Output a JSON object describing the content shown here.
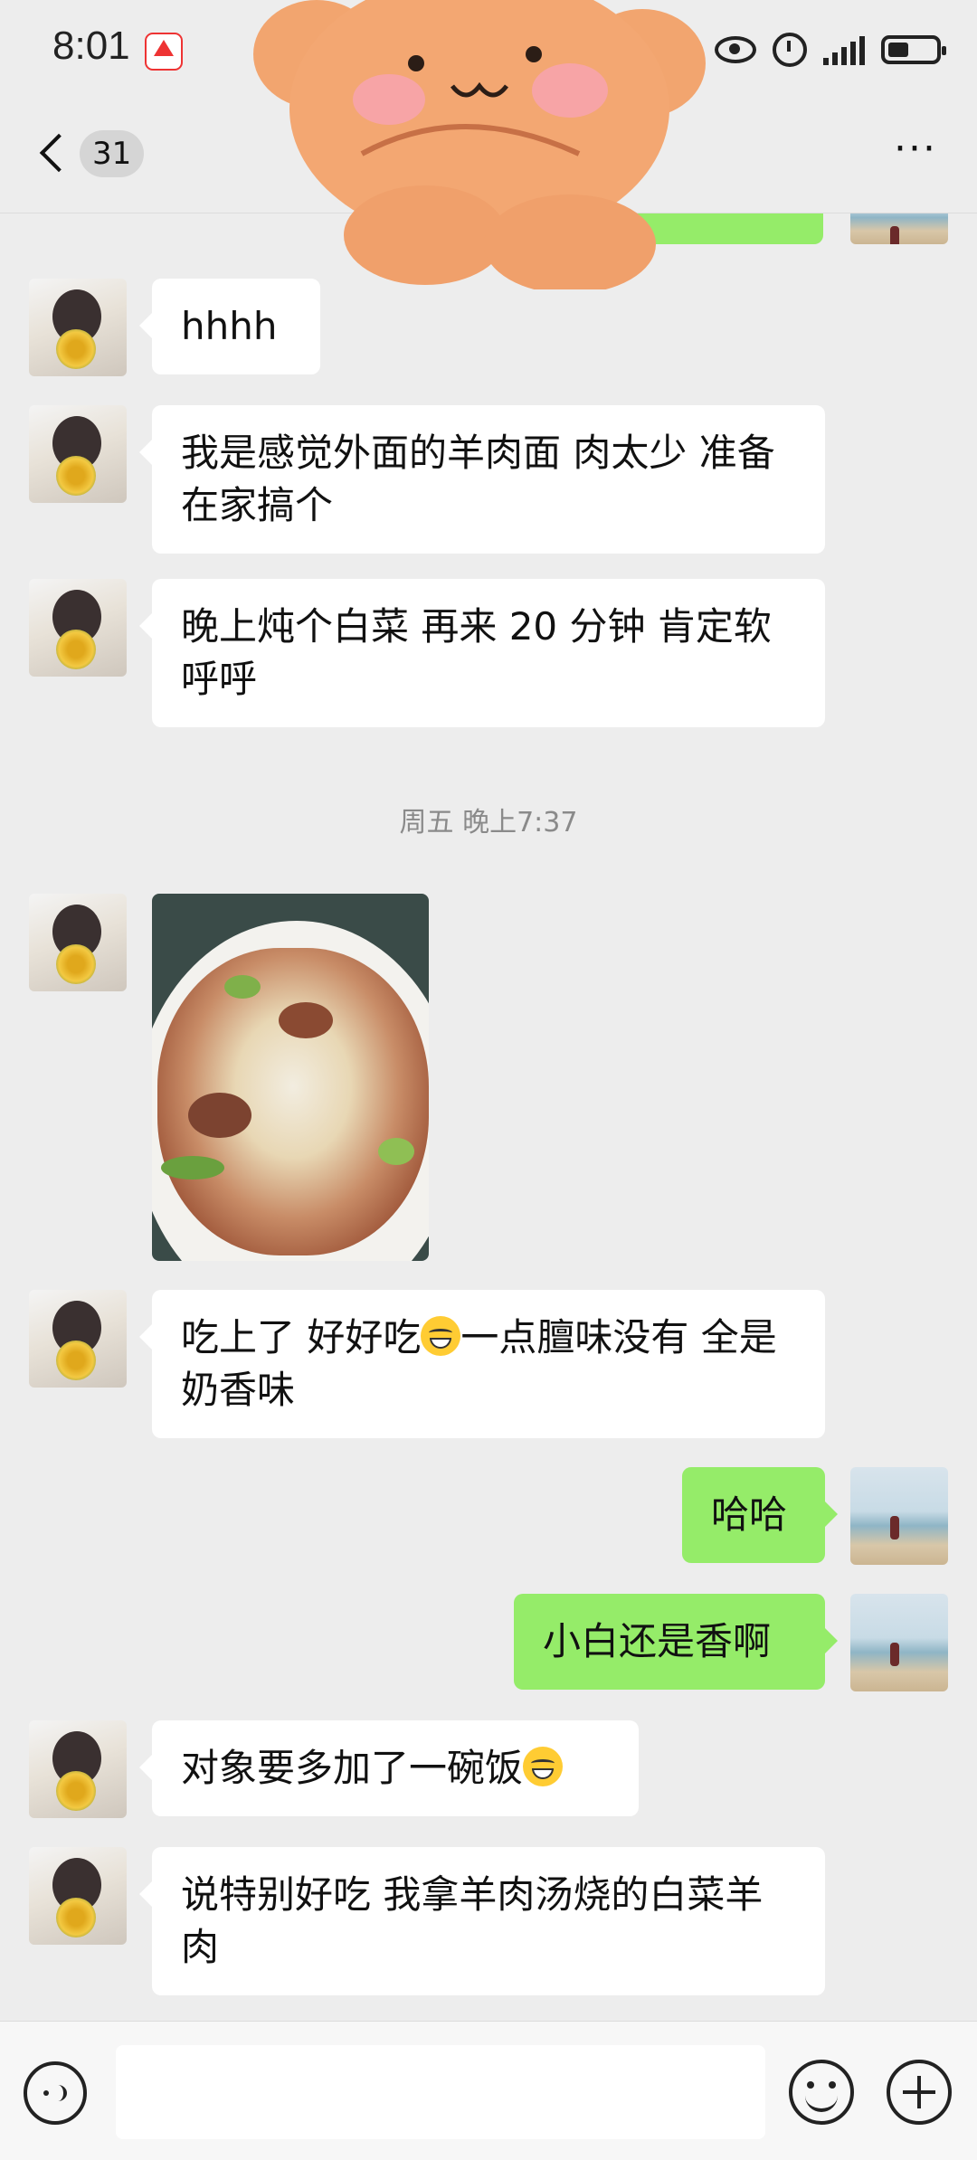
{
  "status_bar": {
    "time": "8:01",
    "icons": [
      "app-notification-icon",
      "eye-icon",
      "alarm-icon",
      "signal-icon",
      "battery-icon"
    ]
  },
  "header": {
    "back_icon": "chevron-left-icon",
    "unread_count": "31",
    "more_label": "···"
  },
  "messages": [
    {
      "sender": "friend",
      "type": "text",
      "text": "hhhh"
    },
    {
      "sender": "friend",
      "type": "text",
      "text": "我是感觉外面的羊肉面 肉太少  准备在家搞个"
    },
    {
      "sender": "friend",
      "type": "text",
      "text": "晚上炖个白菜  再来 20 分钟  肯定软呼呼"
    },
    {
      "type": "timestamp",
      "text": "周五 晚上7:37"
    },
    {
      "sender": "friend",
      "type": "image",
      "subject": "lamb-cabbage-stew-photo"
    },
    {
      "sender": "friend",
      "type": "text",
      "text_before": "吃上了 好好吃",
      "emoji": "laughing-tears-emoji",
      "text_after": "一点膻味没有 全是奶香味"
    },
    {
      "sender": "me",
      "type": "text",
      "text": "哈哈"
    },
    {
      "sender": "me",
      "type": "text",
      "text": "小白还是香啊"
    },
    {
      "sender": "friend",
      "type": "text",
      "text_before": "对象要多加了一碗饭",
      "emoji": "laughing-tears-emoji",
      "text_after": ""
    },
    {
      "sender": "friend",
      "type": "text",
      "text": "说特别好吃  我拿羊肉汤烧的白菜羊肉"
    }
  ],
  "input_bar": {
    "voice_icon": "voice-icon",
    "input_value": "",
    "emoji_icon": "smiley-icon",
    "plus_icon": "plus-icon"
  },
  "colors": {
    "background": "#ededed",
    "sent_bubble": "#95ec69",
    "received_bubble": "#ffffff"
  }
}
